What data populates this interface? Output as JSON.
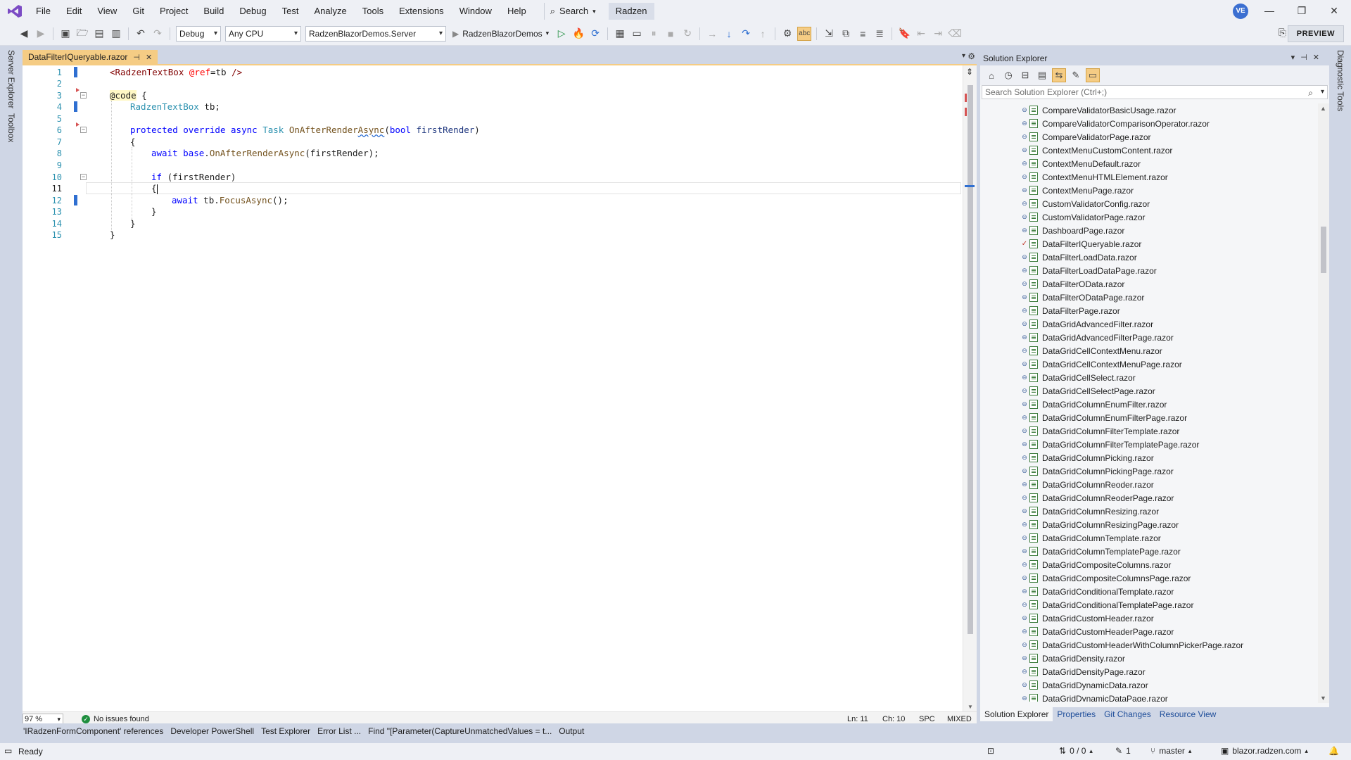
{
  "menubar": {
    "items": [
      "File",
      "Edit",
      "View",
      "Git",
      "Project",
      "Build",
      "Debug",
      "Test",
      "Analyze",
      "Tools",
      "Extensions",
      "Window",
      "Help"
    ],
    "search_label": "Search",
    "solution_name": "Radzen",
    "avatar_initials": "VE"
  },
  "toolbar": {
    "configuration": "Debug",
    "platform": "Any CPU",
    "startup_project": "RadzenBlazorDemos.Server",
    "run_target": "RadzenBlazorDemos",
    "preview_label": "PREVIEW"
  },
  "side_strip": {
    "server_explorer": "Server Explorer",
    "toolbox": "Toolbox",
    "diagnostic_tools": "Diagnostic Tools"
  },
  "editor": {
    "tab_title": "DataFilterIQueryable.razor",
    "current_line": 11,
    "line_numbers": [
      "1",
      "2",
      "3",
      "4",
      "5",
      "6",
      "7",
      "8",
      "9",
      "10",
      "11",
      "12",
      "13",
      "14",
      "15"
    ],
    "code": {
      "l1_tag_open": "<RadzenTextBox ",
      "l1_attr": "@ref",
      "l1_rest": "=tb ",
      "l1_tag_close": "/>",
      "l3_at": "@code",
      "l3_brace": " {",
      "l4_type": "RadzenTextBox",
      "l4_rest": " tb;",
      "l6_protected": "protected",
      "l6_override": "override",
      "l6_async": "async",
      "l6_task": "Task",
      "l6_method_a": "OnAfterRender",
      "l6_method_b": "Async",
      "l6_paren": "(",
      "l6_bool": "bool",
      "l6_param": "firstRender",
      "l6_close": ")",
      "l7": "{",
      "l8_await": "await",
      "l8_base": "base",
      "l8_dot": ".",
      "l8_method": "OnAfterRenderAsync",
      "l8_arg": "(firstRender);",
      "l10_if": "if",
      "l10_rest": " (firstRender)",
      "l11": "{",
      "l12_await": "await",
      "l12_obj": " tb.",
      "l12_method": "FocusAsync",
      "l12_rest": "();",
      "l13": "}",
      "l14": "}",
      "l15": "}"
    }
  },
  "editor_status": {
    "zoom": "97 %",
    "issues": "No issues found",
    "line": "Ln: 11",
    "col": "Ch: 10",
    "whitespace": "SPC",
    "line_endings": "MIXED"
  },
  "solution_explorer": {
    "title": "Solution Explorer",
    "search_placeholder": "Search Solution Explorer (Ctrl+;)",
    "items": [
      "CompareValidatorBasicUsage.razor",
      "CompareValidatorComparisonOperator.razor",
      "CompareValidatorPage.razor",
      "ContextMenuCustomContent.razor",
      "ContextMenuDefault.razor",
      "ContextMenuHTMLElement.razor",
      "ContextMenuPage.razor",
      "CustomValidatorConfig.razor",
      "CustomValidatorPage.razor",
      "DashboardPage.razor",
      "DataFilterIQueryable.razor",
      "DataFilterLoadData.razor",
      "DataFilterLoadDataPage.razor",
      "DataFilterOData.razor",
      "DataFilterODataPage.razor",
      "DataFilterPage.razor",
      "DataGridAdvancedFilter.razor",
      "DataGridAdvancedFilterPage.razor",
      "DataGridCellContextMenu.razor",
      "DataGridCellContextMenuPage.razor",
      "DataGridCellSelect.razor",
      "DataGridCellSelectPage.razor",
      "DataGridColumnEnumFilter.razor",
      "DataGridColumnEnumFilterPage.razor",
      "DataGridColumnFilterTemplate.razor",
      "DataGridColumnFilterTemplatePage.razor",
      "DataGridColumnPicking.razor",
      "DataGridColumnPickingPage.razor",
      "DataGridColumnReoder.razor",
      "DataGridColumnReoderPage.razor",
      "DataGridColumnResizing.razor",
      "DataGridColumnResizingPage.razor",
      "DataGridColumnTemplate.razor",
      "DataGridColumnTemplatePage.razor",
      "DataGridCompositeColumns.razor",
      "DataGridCompositeColumnsPage.razor",
      "DataGridConditionalTemplate.razor",
      "DataGridConditionalTemplatePage.razor",
      "DataGridCustomHeader.razor",
      "DataGridCustomHeaderPage.razor",
      "DataGridCustomHeaderWithColumnPickerPage.razor",
      "DataGridDensity.razor",
      "DataGridDensityPage.razor",
      "DataGridDynamicData.razor",
      "DataGridDynamicDataPage.razor"
    ],
    "selected_item": "DataFilterIQueryable.razor",
    "tabs": [
      "Solution Explorer",
      "Properties",
      "Git Changes",
      "Resource View"
    ]
  },
  "bottom_tabs": [
    "'IRadzenFormComponent' references",
    "Developer PowerShell",
    "Test Explorer",
    "Error List ...",
    "Find \"[Parameter(CaptureUnmatchedValues = t...",
    "Output"
  ],
  "statusbar": {
    "ready": "Ready",
    "sync": "0 / 0",
    "pending": "1",
    "branch": "master",
    "repo": "blazor.radzen.com"
  }
}
